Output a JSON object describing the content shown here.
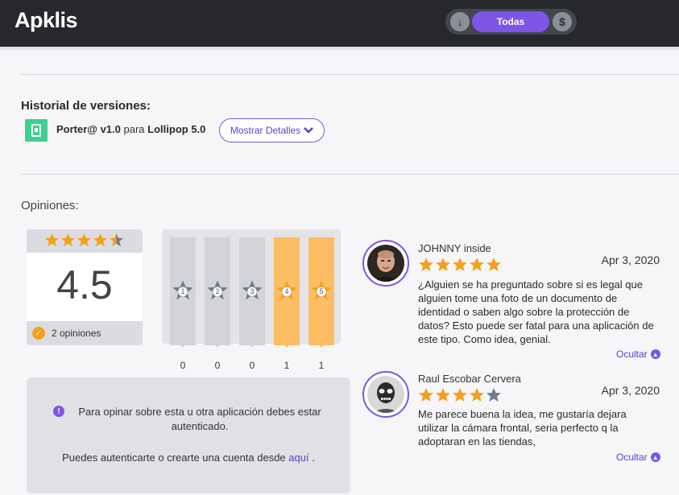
{
  "header": {
    "logo": "Apklis",
    "filter": {
      "left_icon": "download-arrow-icon",
      "active_label": "Todas",
      "right_icon": "dollar-icon"
    }
  },
  "versions": {
    "title": "Historial de versiones:",
    "app_name": "Porter@ v1.0",
    "connector": "para",
    "platform": "Lollipop 5.0",
    "details_button": "Mostrar Detalles"
  },
  "opinions": {
    "title": "Opiniones:",
    "average": "4.5",
    "average_stars": 4.5,
    "count_label": "2 opiniones",
    "distribution": [
      {
        "stars": "1",
        "count": "0",
        "active": false
      },
      {
        "stars": "2",
        "count": "0",
        "active": false
      },
      {
        "stars": "3",
        "count": "0",
        "active": false
      },
      {
        "stars": "4",
        "count": "1",
        "active": true
      },
      {
        "stars": "5",
        "count": "1",
        "active": true
      }
    ]
  },
  "login": {
    "message": "Para opinar sobre esta u otra aplicación debes estar autenticado.",
    "prompt": "Puedes autenticarte o crearte una cuenta desde",
    "link": "aquí",
    "suffix": "."
  },
  "reviews": [
    {
      "author": "JOHNNY inside",
      "stars": 5,
      "date": "Apr 3, 2020",
      "text": "¿Alguien se ha preguntado sobre si es legal que alguien tome una foto de un documento de identidad o saben algo sobre la protección de datos? Esto puede ser fatal para una aplicación de este tipo. Como idea, genial.",
      "toggle": "Ocultar"
    },
    {
      "author": "Raul Escobar Cervera",
      "stars": 4,
      "date": "Apr 3, 2020",
      "text": "Me parece buena la idea, me gustaría dejara utilizar la cámara frontal, seria perfecto q la adoptaran en las tiendas,",
      "toggle": "Ocultar"
    }
  ],
  "colors": {
    "accent": "#7d55e7",
    "star": "#f59f1e",
    "star_empty": "#707a8a",
    "header_bg": "#26282d"
  }
}
